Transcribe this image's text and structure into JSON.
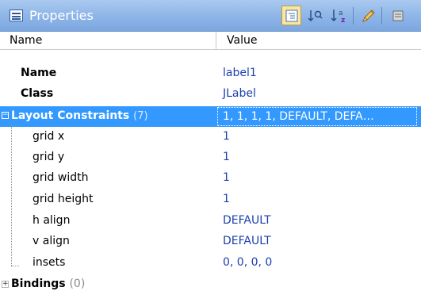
{
  "window": {
    "title": "Properties",
    "icon": "list-window-icon"
  },
  "toolbar": {
    "buttons": [
      {
        "name": "categorized-view-icon",
        "active": true
      },
      {
        "name": "sort-by-category-icon",
        "active": false
      },
      {
        "name": "sort-alphabetical-icon",
        "active": false
      },
      {
        "name": "edit-pencil-icon",
        "active": false
      },
      {
        "name": "more-icon",
        "active": false
      }
    ]
  },
  "columns": {
    "name": "Name",
    "value": "Value"
  },
  "rows": {
    "name": {
      "label": "Name",
      "value": "label1"
    },
    "class": {
      "label": "Class",
      "value": "JLabel"
    },
    "layout": {
      "label": "Layout Constraints",
      "count": "(7)",
      "value": "1, 1, 1, 1, DEFAULT, DEFA…"
    },
    "grid_x": {
      "label": "grid x",
      "value": "1"
    },
    "grid_y": {
      "label": "grid y",
      "value": "1"
    },
    "grid_width": {
      "label": "grid width",
      "value": "1"
    },
    "grid_height": {
      "label": "grid height",
      "value": "1"
    },
    "h_align": {
      "label": "h align",
      "value": "DEFAULT"
    },
    "v_align": {
      "label": "v align",
      "value": "DEFAULT"
    },
    "insets": {
      "label": "insets",
      "value": "0, 0, 0, 0"
    },
    "bindings": {
      "label": "Bindings",
      "count": "(0)"
    }
  },
  "colors": {
    "selection": "#3399ff",
    "value_text": "#1b3fb0",
    "title_gradient": "#8fb6e8"
  }
}
